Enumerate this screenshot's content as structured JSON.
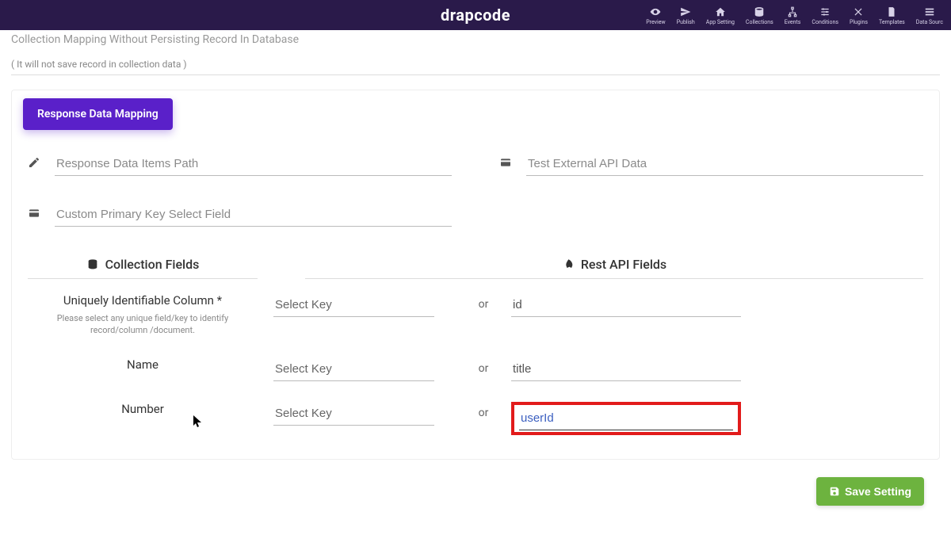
{
  "brand": "drapcode",
  "nav": [
    {
      "label": "Preview",
      "icon": "eye"
    },
    {
      "label": "Publish",
      "icon": "send"
    },
    {
      "label": "App Setting",
      "icon": "home"
    },
    {
      "label": "Collections",
      "icon": "database"
    },
    {
      "label": "Events",
      "icon": "sitemap"
    },
    {
      "label": "Conditions",
      "icon": "sliders"
    },
    {
      "label": "Plugins",
      "icon": "tools"
    },
    {
      "label": "Templates",
      "icon": "file"
    },
    {
      "label": "Data Sourc",
      "icon": "menu"
    }
  ],
  "header": {
    "truncated_title": "Collection Mapping Without Persisting Record In Database",
    "note": "( It will not save record in collection data )"
  },
  "tab": {
    "label": "Response Data Mapping"
  },
  "fields": {
    "response_path_placeholder": "Response Data Items Path",
    "test_api_placeholder": "Test External API Data",
    "primary_key_placeholder": "Custom Primary Key Select Field"
  },
  "sections": {
    "left_title": "Collection Fields",
    "right_title": "Rest API Fields"
  },
  "mapping": {
    "or_label": "or",
    "select_key_placeholder": "Select Key",
    "rows": [
      {
        "label": "Uniquely Identifiable Column *",
        "help": "Please select any unique field/key to identify record/column /document.",
        "value": "id"
      },
      {
        "label": "Name",
        "help": "",
        "value": "title"
      },
      {
        "label": "Number",
        "help": "",
        "value": "userId",
        "highlighted": true
      }
    ]
  },
  "save": {
    "label": "Save Setting"
  }
}
